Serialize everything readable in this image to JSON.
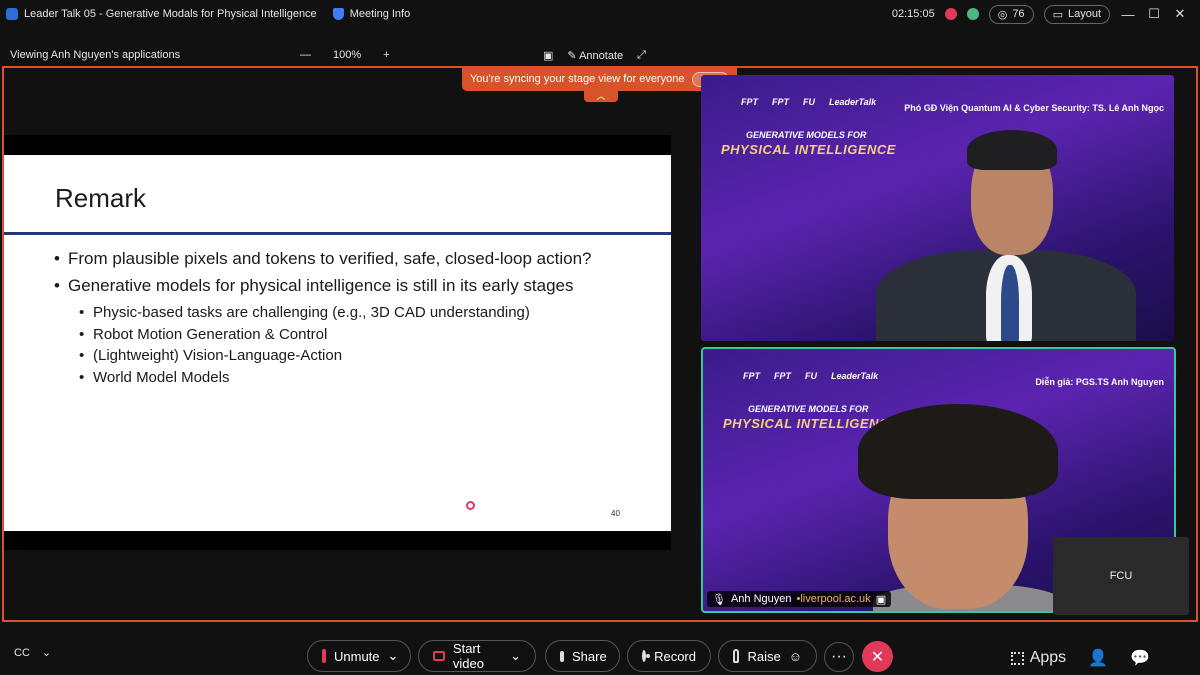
{
  "window": {
    "title": "Leader Talk 05 - Generative Modals for Physical Intelligence",
    "meeting_info": "Meeting Info",
    "clock": "02:15:05",
    "participants_count": "76",
    "layout_label": "Layout",
    "controls": {
      "minimize": "—",
      "maximize": "☐",
      "close": "✕"
    }
  },
  "topbar": {
    "viewing": "Viewing Anh Nguyen's applications",
    "zoom_out": "—",
    "zoom_level": "100%",
    "zoom_in": "+",
    "annotate": "Annotate"
  },
  "sync_banner": {
    "text": "You're syncing your stage view for everyone",
    "stop": "Stop",
    "collapse": "︿"
  },
  "slide": {
    "title": "Remark",
    "bullets": [
      "From plausible pixels and tokens to verified, safe, closed-loop action?",
      "Generative models for physical intelligence is still in its early stages"
    ],
    "sub_bullets": [
      "Physic-based tasks are challenging (e.g., 3D CAD understanding)",
      "Robot Motion Generation & Control",
      "(Lightweight) Vision-Language-Action",
      "World Model Models"
    ],
    "bullet_char": "•",
    "page_number": "40"
  },
  "video1": {
    "logos": [
      "FPT",
      "FPT",
      "FU",
      "LeaderTalk"
    ],
    "event_line1": "GENERATIVE MODELS FOR",
    "event_line2": "PHYSICAL INTELLIGENCE",
    "caption": "Phó GĐ Viện Quantum AI & Cyber Security: TS. Lê Anh Ngọc"
  },
  "video2": {
    "logos": [
      "FPT",
      "FPT",
      "FU",
      "LeaderTalk"
    ],
    "event_line1": "GENERATIVE MODELS FOR",
    "event_line2": "PHYSICAL INTELLIGENCE",
    "caption": "Diễn giả: PGS.TS Anh Nguyen",
    "name": "Anh Nguyen",
    "domain": "•liverpool.ac.uk"
  },
  "fcu_tile": "FCU",
  "bottombar": {
    "unmute": "Unmute",
    "start_video": "Start video",
    "share": "Share",
    "record": "Record",
    "raise": "Raise",
    "more": "···",
    "end": "✕",
    "apps": "Apps",
    "chevron": "⌄"
  },
  "colors": {
    "accent_orange": "#d9532a",
    "end_red": "#e0395a",
    "active_speaker": "#36c9a0",
    "slide_rule": "#24357a"
  }
}
